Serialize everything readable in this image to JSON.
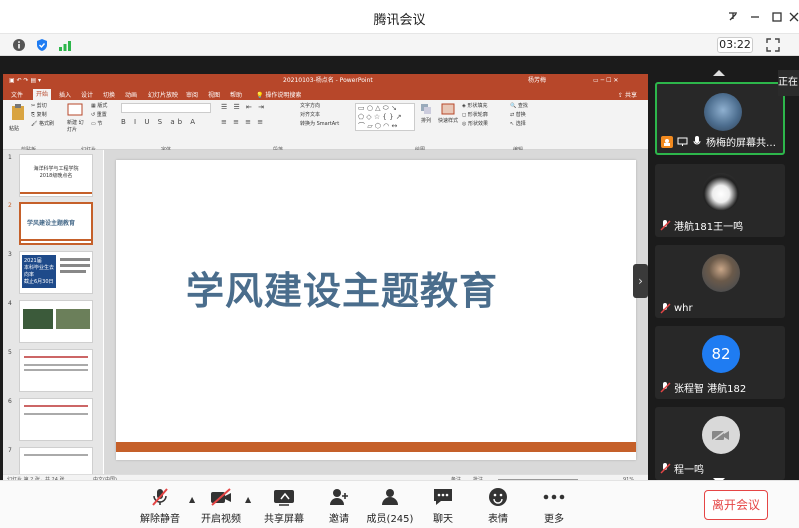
{
  "window": {
    "title": "腾讯会议"
  },
  "infobar": {
    "timer": "03:22"
  },
  "ppt": {
    "doc_title": "20210103-杨点名 - PowerPoint",
    "user": "杨芳梅",
    "tabs": [
      "文件",
      "开始",
      "插入",
      "设计",
      "切换",
      "动画",
      "幻灯片放映",
      "审阅",
      "视图",
      "帮助",
      "操作说明搜索"
    ],
    "share": "共享",
    "ribbon_groups": [
      "剪贴板",
      "幻灯片",
      "字体",
      "段落",
      "绘图",
      "编辑"
    ],
    "ribbon_items": {
      "paste": "粘贴",
      "cut": "剪切",
      "copy": "复制",
      "format_painter": "格式刷",
      "new_slide": "新建\n幻灯片",
      "layout": "版式",
      "reset": "重置",
      "section": "节",
      "text_direction": "文字方向",
      "align_text": "对齐文本",
      "smartart": "转换为 SmartArt",
      "arrange": "排列",
      "quick_styles": "快速样式",
      "shape_fill": "形状填充",
      "shape_outline": "形状轮廓",
      "shape_effects": "形状效果",
      "find": "查找",
      "replace": "替换",
      "select": "选择"
    },
    "thumbs": [
      {
        "num": "1",
        "text": "海洋科学与工程学院\n2018级晚点名"
      },
      {
        "num": "2",
        "text": "学风建设主题教育"
      },
      {
        "num": "3",
        "text": "2021届\n本科毕业生去向率\n截止6月30日"
      },
      {
        "num": "4",
        "text": ""
      },
      {
        "num": "5",
        "text": ""
      },
      {
        "num": "6",
        "text": ""
      },
      {
        "num": "7",
        "text": ""
      }
    ],
    "slide_title": "学风建设主题教育",
    "status_left": "幻灯片 第 2 张，共 24 张",
    "status_lang": "中文(中国)",
    "status_notes": "备注",
    "status_comments": "批注",
    "zoom": "91%"
  },
  "participants": [
    {
      "name": "杨梅的屏幕共…",
      "type": "photo"
    },
    {
      "name": "港航181王一鸣",
      "type": "cat"
    },
    {
      "name": "whr",
      "type": "person"
    },
    {
      "name": "张程智 港航182",
      "type": "initials",
      "initials": "82",
      "color": "#1f7cf2"
    },
    {
      "name": "程一鸣",
      "type": "camera-off"
    }
  ],
  "toast": "正在",
  "toolbar": {
    "mute": "解除静音",
    "video": "开启视频",
    "share": "共享屏幕",
    "invite": "邀请",
    "members": "成员(245)",
    "chat": "聊天",
    "reactions": "表情",
    "more": "更多",
    "leave": "离开会议"
  }
}
